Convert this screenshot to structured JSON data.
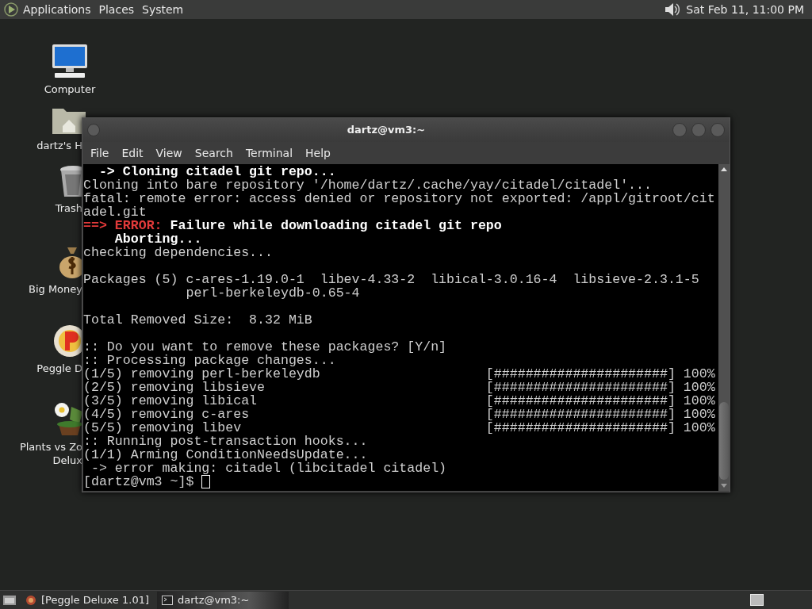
{
  "top_panel": {
    "menus": [
      "Applications",
      "Places",
      "System"
    ],
    "clock": "Sat Feb 11, 11:00 PM"
  },
  "desktop_icons": [
    {
      "kind": "computer",
      "lines": [
        "Computer"
      ]
    },
    {
      "kind": "home",
      "lines": [
        "dartz's H"
      ]
    },
    {
      "kind": "trash",
      "lines": [
        "Trash"
      ]
    },
    {
      "kind": "money",
      "lines": [
        "Big Money"
      ]
    },
    {
      "kind": "peggle",
      "lines": [
        "Peggle D"
      ]
    },
    {
      "kind": "plants",
      "lines": [
        "Plants vs Zo",
        "Delux"
      ]
    }
  ],
  "window": {
    "title": "dartz@vm3:~",
    "menu": [
      "File",
      "Edit",
      "View",
      "Search",
      "Terminal",
      "Help"
    ],
    "terminal_lines": [
      {
        "kind": "text",
        "segments": [
          {
            "kind": "bold",
            "text": "  -> Cloning citadel git repo..."
          }
        ]
      },
      {
        "kind": "text",
        "segments": [
          {
            "kind": "plain",
            "text": "Cloning into bare repository '/home/dartz/.cache/yay/citadel/citadel'..."
          }
        ]
      },
      {
        "kind": "text",
        "segments": [
          {
            "kind": "plain",
            "text": "fatal: remote error: access denied or repository not exported: /appl/gitroot/cit"
          }
        ]
      },
      {
        "kind": "text",
        "segments": [
          {
            "kind": "plain",
            "text": "adel.git"
          }
        ]
      },
      {
        "kind": "text",
        "segments": [
          {
            "kind": "error",
            "text": "==> ERROR:"
          },
          {
            "kind": "bold",
            "text": " Failure while downloading citadel git repo"
          }
        ]
      },
      {
        "kind": "text",
        "segments": [
          {
            "kind": "bold",
            "text": "    Aborting..."
          }
        ]
      },
      {
        "kind": "text",
        "segments": [
          {
            "kind": "plain",
            "text": "checking dependencies..."
          }
        ]
      },
      {
        "kind": "blank"
      },
      {
        "kind": "text",
        "segments": [
          {
            "kind": "plain",
            "text": "Packages (5) c-ares-1.19.0-1  libev-4.33-2  libical-3.0.16-4  libsieve-2.3.1-5"
          }
        ]
      },
      {
        "kind": "text",
        "segments": [
          {
            "kind": "plain",
            "text": "             perl-berkeleydb-0.65-4"
          }
        ]
      },
      {
        "kind": "blank"
      },
      {
        "kind": "text",
        "segments": [
          {
            "kind": "plain",
            "text": "Total Removed Size:  8.32 MiB"
          }
        ]
      },
      {
        "kind": "blank"
      },
      {
        "kind": "text",
        "segments": [
          {
            "kind": "plain",
            "text": ":: Do you want to remove these packages? [Y/n]"
          }
        ]
      },
      {
        "kind": "text",
        "segments": [
          {
            "kind": "plain",
            "text": ":: Processing package changes..."
          }
        ]
      },
      {
        "kind": "text",
        "segments": [
          {
            "kind": "plain",
            "text": "(1/5) removing perl-berkeleydb                     [######################] 100%"
          }
        ]
      },
      {
        "kind": "text",
        "segments": [
          {
            "kind": "plain",
            "text": "(2/5) removing libsieve                            [######################] 100%"
          }
        ]
      },
      {
        "kind": "text",
        "segments": [
          {
            "kind": "plain",
            "text": "(3/5) removing libical                             [######################] 100%"
          }
        ]
      },
      {
        "kind": "text",
        "segments": [
          {
            "kind": "plain",
            "text": "(4/5) removing c-ares                              [######################] 100%"
          }
        ]
      },
      {
        "kind": "text",
        "segments": [
          {
            "kind": "plain",
            "text": "(5/5) removing libev                               [######################] 100%"
          }
        ]
      },
      {
        "kind": "text",
        "segments": [
          {
            "kind": "plain",
            "text": ":: Running post-transaction hooks..."
          }
        ]
      },
      {
        "kind": "text",
        "segments": [
          {
            "kind": "plain",
            "text": "(1/1) Arming ConditionNeedsUpdate..."
          }
        ]
      },
      {
        "kind": "text",
        "segments": [
          {
            "kind": "plain",
            "text": " -> error making: citadel (libcitadel citadel)"
          }
        ]
      },
      {
        "kind": "prompt",
        "segments": [
          {
            "kind": "plain",
            "text": "[dartz@vm3 ~]$ "
          }
        ]
      }
    ]
  },
  "taskbar": {
    "tasks": [
      {
        "kind": "game",
        "label": "[Peggle Deluxe 1.01]",
        "selected": false
      },
      {
        "kind": "terminal",
        "label": "dartz@vm3:~",
        "selected": true
      }
    ]
  }
}
